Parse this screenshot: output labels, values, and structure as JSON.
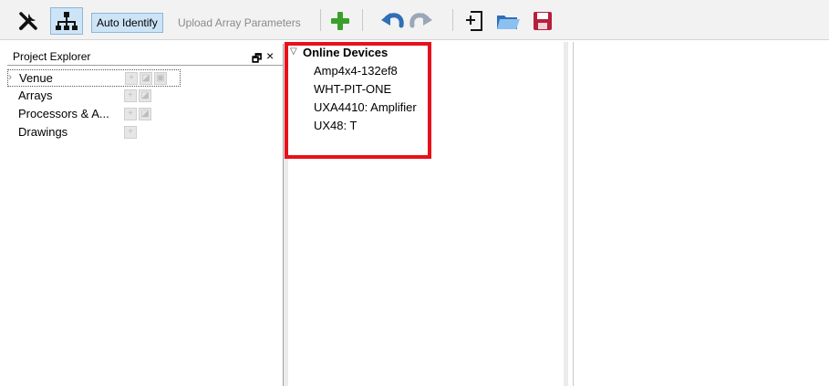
{
  "toolbar": {
    "tools_icon": "tools-icon",
    "network_icon": "network-icon",
    "auto_identify_label": "Auto Identify",
    "upload_array_parameters_label": "Upload Array Parameters",
    "add_icon": "plus-icon",
    "undo_icon": "undo-icon",
    "redo_icon": "redo-icon",
    "new_icon": "new-document-icon",
    "open_icon": "open-folder-icon",
    "save_icon": "save-icon",
    "colors": {
      "accent_green": "#3aa02c",
      "undo_blue": "#2f6fb8",
      "save_red": "#b5203b",
      "active_bg": "#cde4f7"
    }
  },
  "project_explorer": {
    "title": "Project Explorer",
    "float_glyph": "🗗",
    "close_glyph": "×",
    "items": [
      {
        "label": "Venue"
      },
      {
        "label": "Arrays"
      },
      {
        "label": "Processors & A..."
      },
      {
        "label": "Drawings"
      }
    ]
  },
  "online_devices": {
    "header": "Online Devices",
    "devices": [
      {
        "label": "Amp4x4-132ef8"
      },
      {
        "label": "WHT-PIT-ONE"
      },
      {
        "label": "UXA4410: Amplifier"
      },
      {
        "label": "UX48: T"
      }
    ],
    "highlight_color": "#e8101a"
  }
}
